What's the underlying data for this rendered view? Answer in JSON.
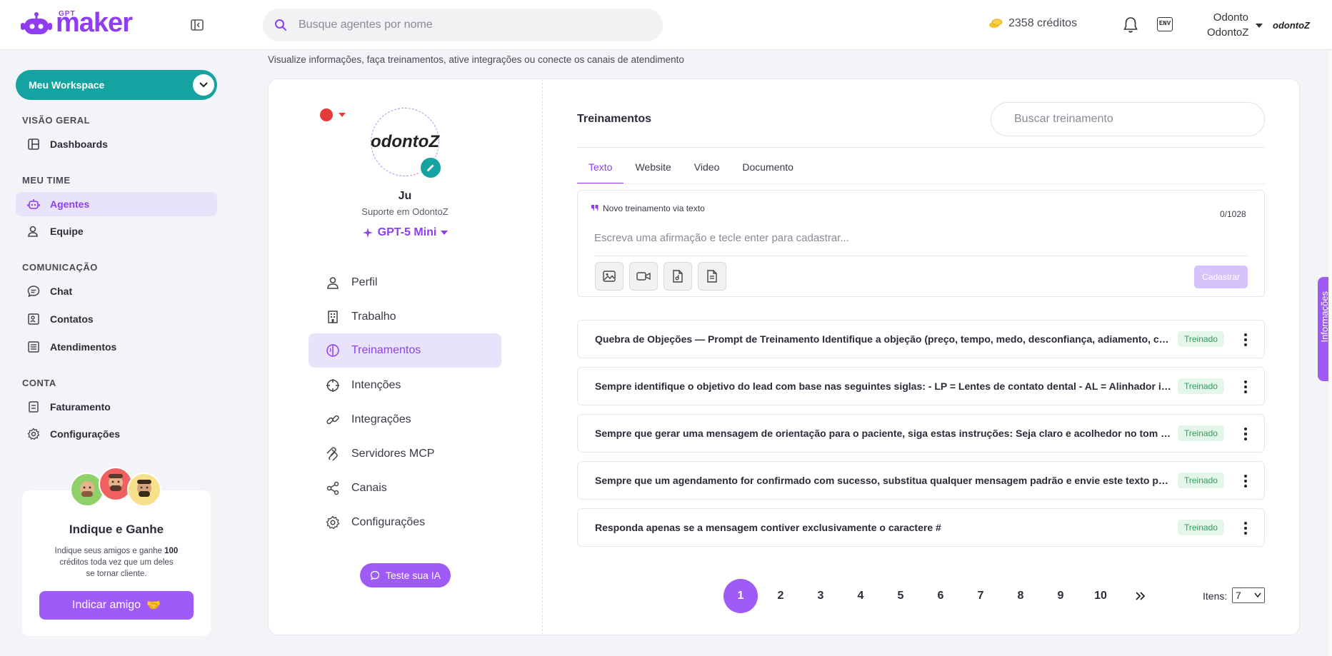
{
  "brand": {
    "sup": "GPT",
    "name": "maker",
    "color": "#8e3ef0"
  },
  "header": {
    "search_placeholder": "Busque agentes por nome",
    "credits": "2358 créditos",
    "env_label": "ENV",
    "user_name": "Odonto",
    "user_org": "OdontoZ",
    "org_logo": "odontoZ"
  },
  "sidebar": {
    "workspace": "Meu Workspace",
    "sections": [
      {
        "title": "VISÃO GERAL",
        "items": [
          {
            "label": "Dashboards",
            "icon": "dashboard-icon"
          }
        ]
      },
      {
        "title": "MEU TIME",
        "items": [
          {
            "label": "Agentes",
            "icon": "robot-icon",
            "active": true
          },
          {
            "label": "Equipe",
            "icon": "team-icon"
          }
        ]
      },
      {
        "title": "COMUNICAÇÃO",
        "items": [
          {
            "label": "Chat",
            "icon": "chat-icon"
          },
          {
            "label": "Contatos",
            "icon": "contacts-icon"
          },
          {
            "label": "Atendimentos",
            "icon": "list-icon"
          }
        ]
      },
      {
        "title": "CONTA",
        "items": [
          {
            "label": "Faturamento",
            "icon": "billing-icon"
          },
          {
            "label": "Configurações",
            "icon": "gear-icon"
          }
        ]
      }
    ],
    "refer": {
      "title": "Indique e Ganhe",
      "text_before": "Indique seus amigos e ganhe ",
      "text_bold": "100",
      "text_after": " créditos toda vez que um deles se tornar cliente.",
      "button": "Indicar amigo",
      "button_emoji": "🤝"
    }
  },
  "page": {
    "subtitle": "Visualize informações, faça treinamentos, ative integrações ou conecte os canais de atendimento"
  },
  "agent": {
    "avatar_text": "odontoZ",
    "name": "Ju",
    "role": "Suporte em OdontoZ",
    "model": "GPT-5 Mini",
    "status_color": "#e83a3a",
    "menu": [
      {
        "label": "Perfil",
        "icon": "user-icon"
      },
      {
        "label": "Trabalho",
        "icon": "building-icon"
      },
      {
        "label": "Treinamentos",
        "icon": "brain-icon",
        "active": true
      },
      {
        "label": "Intenções",
        "icon": "crosshair-icon"
      },
      {
        "label": "Integrações",
        "icon": "link-icon"
      },
      {
        "label": "Servidores MCP",
        "icon": "mcp-icon"
      },
      {
        "label": "Canais",
        "icon": "share-icon"
      },
      {
        "label": "Configurações",
        "icon": "gear-icon"
      }
    ],
    "test_button": "Teste sua IA"
  },
  "training": {
    "title": "Treinamentos",
    "search_placeholder": "Buscar treinamento",
    "tabs": [
      "Texto",
      "Website",
      "Video",
      "Documento"
    ],
    "active_tab": 0,
    "editor": {
      "label": "Novo treinamento via texto",
      "count": "0/1028",
      "placeholder": "Escreva uma afirmação e tecle enter para cadastrar...",
      "submit": "Cadastrar",
      "tools": [
        "image-icon",
        "video-icon",
        "audio-file-icon",
        "document-icon"
      ]
    },
    "items": [
      {
        "text": "Quebra de Objeções — Prompt de Treinamento Identifique a objeção (preço, tempo, medo, desconfiança, adiamento, comparação...",
        "status": "Treinado"
      },
      {
        "text": "Sempre identifique o objetivo do lead com base nas seguintes siglas: - LP = Lentes de contato dental - AL = Alinhador invisível...",
        "status": "Treinado"
      },
      {
        "text": "Sempre que gerar uma mensagem de orientação para o paciente, siga estas instruções: Seja claro e acolhedor no tom da mensagem...",
        "status": "Treinado"
      },
      {
        "text": "Sempre que um agendamento for confirmado com sucesso, substitua qualquer mensagem padrão e envie este texto personalizado...",
        "status": "Treinado"
      },
      {
        "text": "Responda apenas se a mensagem contiver exclusivamente o caractere #",
        "status": "Treinado"
      }
    ],
    "pagination": {
      "pages": [
        "1",
        "2",
        "3",
        "4",
        "5",
        "6",
        "7",
        "8",
        "9",
        "10"
      ],
      "current": "1",
      "next": "»",
      "items_label": "Itens:",
      "items_value": "7"
    }
  },
  "info_tab": "Informações"
}
